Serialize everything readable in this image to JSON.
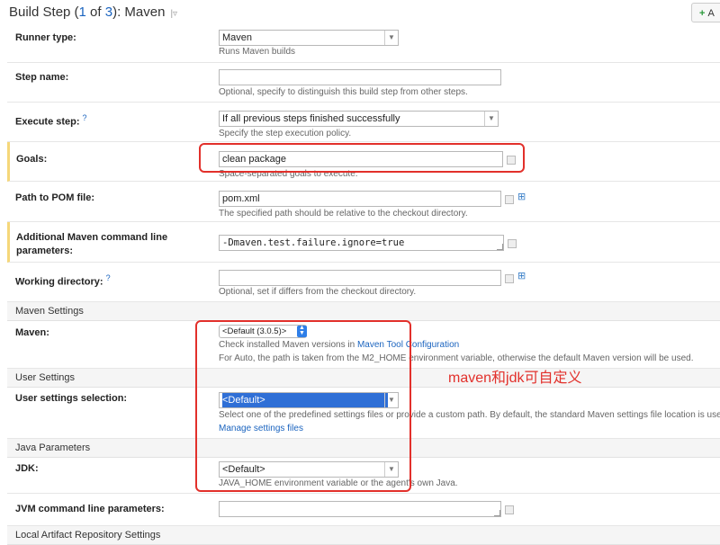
{
  "header": {
    "title_prefix": "Build Step (",
    "step_current": "1",
    "title_of": " of ",
    "step_total": "3",
    "title_suffix": "): Maven",
    "caret": "|▿",
    "add_label": "A"
  },
  "fields": {
    "runner_type": {
      "label": "Runner type:",
      "value": "Maven",
      "note": "Runs Maven builds"
    },
    "step_name": {
      "label": "Step name:",
      "value": "",
      "note": "Optional, specify to distinguish this build step from other steps."
    },
    "execute_step": {
      "label": "Execute step:",
      "help": "?",
      "value": "If all previous steps finished successfully",
      "note": "Specify the step execution policy."
    },
    "goals": {
      "label": "Goals:",
      "value": "clean package",
      "note": "Space-separated goals to execute."
    },
    "pom": {
      "label": "Path to POM file:",
      "value": "pom.xml",
      "note": "The specified path should be relative to the checkout directory."
    },
    "additional": {
      "label_line1": "Additional Maven command line",
      "label_line2": "parameters:",
      "value": "-Dmaven.test.failure.ignore=true"
    },
    "working_dir": {
      "label": "Working directory:",
      "help": "?",
      "value": "",
      "note": "Optional, set if differs from the checkout directory."
    }
  },
  "maven_settings": {
    "section": "Maven Settings",
    "label": "Maven:",
    "value": "<Default (3.0.5)>",
    "note1_prefix": "Check installed Maven versions in ",
    "note1_link": "Maven Tool Configuration",
    "note2": "For Auto, the path is taken from the M2_HOME environment variable, otherwise the default Maven version will be used."
  },
  "user_settings": {
    "section": "User Settings",
    "label": "User settings selection:",
    "value": "<Default>",
    "note": "Select one of the predefined settings files or provide a custom path. By default, the standard Maven settings file location is used.",
    "link": "Manage settings files"
  },
  "java_params": {
    "section": "Java Parameters",
    "jdk_label": "JDK:",
    "jdk_value": "<Default>",
    "jdk_note": "JAVA_HOME environment variable or the agent's own Java.",
    "jvm_label": "JVM command line parameters:",
    "jvm_value": ""
  },
  "bottom_section": "Local Artifact Repository Settings",
  "annotation": "maven和jdk可自定义",
  "colors": {
    "annotation": "#e2302b",
    "link": "#1b64bf",
    "highlight": "#f5d77a"
  }
}
